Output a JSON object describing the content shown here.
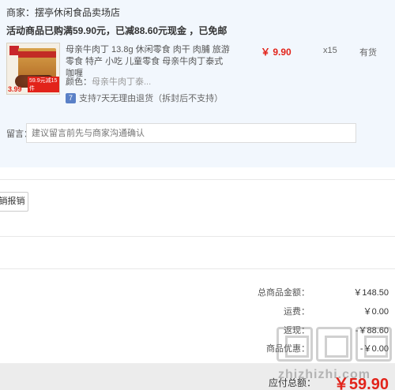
{
  "order": {
    "merchant": "商家：摆亭休闲食品卖场店",
    "promo": "活动商品已购满59.90元，已减88.60元现金 ，已免邮",
    "item": {
      "thumb_price_a": "3.99",
      "thumb_price_b": "59.9元减15件",
      "title": "母亲牛肉丁 13.8g 休闲零食 肉干 肉脯 旅游零食 特产 小吃 儿童零食 母亲牛肉丁泰式咖喱",
      "price": "￥ 9.90",
      "quantity": "x15",
      "stock": "有货",
      "color_label": "颜色：",
      "color_value": "母亲牛肉丁泰...",
      "return_icon": "7",
      "return_text": "支持7天无理由退货（拆封后不支持）"
    },
    "message_label": "留言：",
    "message_placeholder": "建议留言前先与商家沟通确认"
  },
  "invoice_button": "销报销",
  "summary": {
    "goods_total_label": "总商品金额：",
    "goods_total_value": "￥148.50",
    "shipping_label": "运费：",
    "shipping_value": "￥0.00",
    "discount_label": "返现：",
    "discount_value": "-￥88.60",
    "coupon_label": "商品优惠：",
    "coupon_value": "-￥0.00",
    "payable_label": "应付总额：",
    "payable_value": "￥59.90"
  },
  "watermark": "zhizhizhi.com"
}
